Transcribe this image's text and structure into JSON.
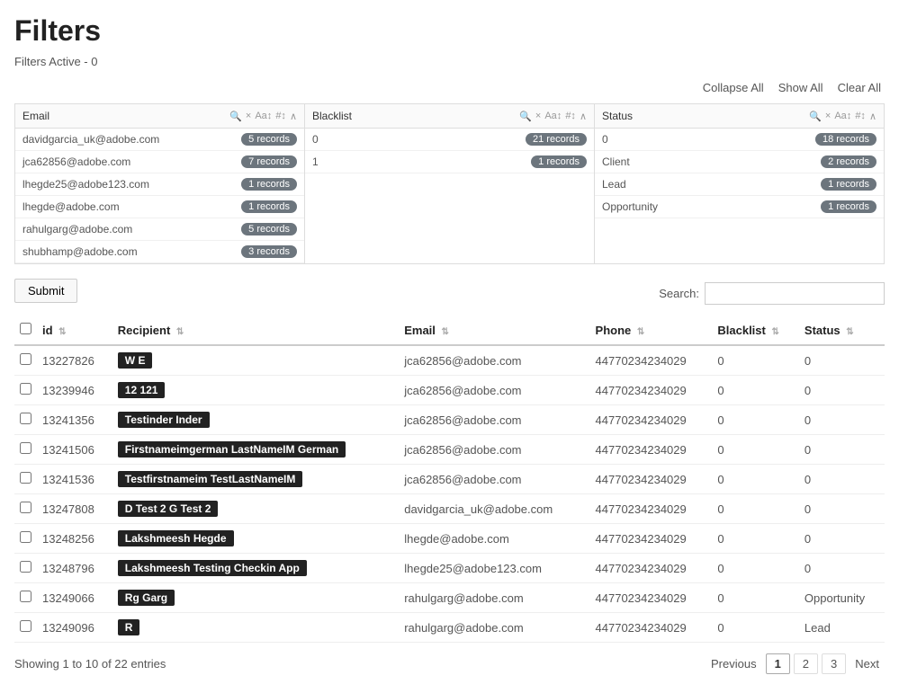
{
  "page": {
    "title": "Filters",
    "filters_active_label": "Filters Active - 0"
  },
  "filter_actions": {
    "collapse_all": "Collapse All",
    "show_all": "Show All",
    "clear_all": "Clear All"
  },
  "filter_panels": [
    {
      "id": "email",
      "title": "Email",
      "rows": [
        {
          "label": "davidgarcia_uk@adobe.com",
          "count": "5 records"
        },
        {
          "label": "jca62856@adobe.com",
          "count": "7 records"
        },
        {
          "label": "lhegde25@adobe123.com",
          "count": "1 records"
        },
        {
          "label": "lhegde@adobe.com",
          "count": "1 records"
        },
        {
          "label": "rahulgarg@adobe.com",
          "count": "5 records"
        },
        {
          "label": "shubhamp@adobe.com",
          "count": "3 records"
        }
      ]
    },
    {
      "id": "blacklist",
      "title": "Blacklist",
      "rows": [
        {
          "label": "0",
          "count": "21 records"
        },
        {
          "label": "1",
          "count": "1 records"
        }
      ]
    },
    {
      "id": "status",
      "title": "Status",
      "rows": [
        {
          "label": "0",
          "count": "18 records"
        },
        {
          "label": "Client",
          "count": "2 records"
        },
        {
          "label": "Lead",
          "count": "1 records"
        },
        {
          "label": "Opportunity",
          "count": "1 records"
        }
      ]
    }
  ],
  "search": {
    "label": "Search:",
    "placeholder": ""
  },
  "submit_button": "Submit",
  "table": {
    "columns": [
      {
        "key": "id",
        "label": "id",
        "sortable": true
      },
      {
        "key": "recipient",
        "label": "Recipient",
        "sortable": true
      },
      {
        "key": "email",
        "label": "Email",
        "sortable": true
      },
      {
        "key": "phone",
        "label": "Phone",
        "sortable": true
      },
      {
        "key": "blacklist",
        "label": "Blacklist",
        "sortable": true
      },
      {
        "key": "status",
        "label": "Status",
        "sortable": true
      }
    ],
    "rows": [
      {
        "id": "13227826",
        "recipient": "W E",
        "email": "jca62856@adobe.com",
        "phone": "44770234234029",
        "blacklist": "0",
        "status": "0"
      },
      {
        "id": "13239946",
        "recipient": "12 121",
        "email": "jca62856@adobe.com",
        "phone": "44770234234029",
        "blacklist": "0",
        "status": "0"
      },
      {
        "id": "13241356",
        "recipient": "Testinder Inder",
        "email": "jca62856@adobe.com",
        "phone": "44770234234029",
        "blacklist": "0",
        "status": "0"
      },
      {
        "id": "13241506",
        "recipient": "Firstnameimgerman LastNameIM German",
        "email": "jca62856@adobe.com",
        "phone": "44770234234029",
        "blacklist": "0",
        "status": "0"
      },
      {
        "id": "13241536",
        "recipient": "Testfirstnameim TestLastNameIM",
        "email": "jca62856@adobe.com",
        "phone": "44770234234029",
        "blacklist": "0",
        "status": "0"
      },
      {
        "id": "13247808",
        "recipient": "D Test 2 G Test 2",
        "email": "davidgarcia_uk@adobe.com",
        "phone": "44770234234029",
        "blacklist": "0",
        "status": "0"
      },
      {
        "id": "13248256",
        "recipient": "Lakshmeesh Hegde",
        "email": "lhegde@adobe.com",
        "phone": "44770234234029",
        "blacklist": "0",
        "status": "0"
      },
      {
        "id": "13248796",
        "recipient": "Lakshmeesh Testing Checkin App",
        "email": "lhegde25@adobe123.com",
        "phone": "44770234234029",
        "blacklist": "0",
        "status": "0"
      },
      {
        "id": "13249066",
        "recipient": "Rg Garg",
        "email": "rahulgarg@adobe.com",
        "phone": "44770234234029",
        "blacklist": "0",
        "status": "Opportunity"
      },
      {
        "id": "13249096",
        "recipient": "R",
        "email": "rahulgarg@adobe.com",
        "phone": "44770234234029",
        "blacklist": "0",
        "status": "Lead"
      }
    ]
  },
  "pagination": {
    "showing": "Showing 1 to 10 of 22 entries",
    "previous": "Previous",
    "next": "Next",
    "pages": [
      "1",
      "2",
      "3"
    ],
    "active_page": "1"
  }
}
